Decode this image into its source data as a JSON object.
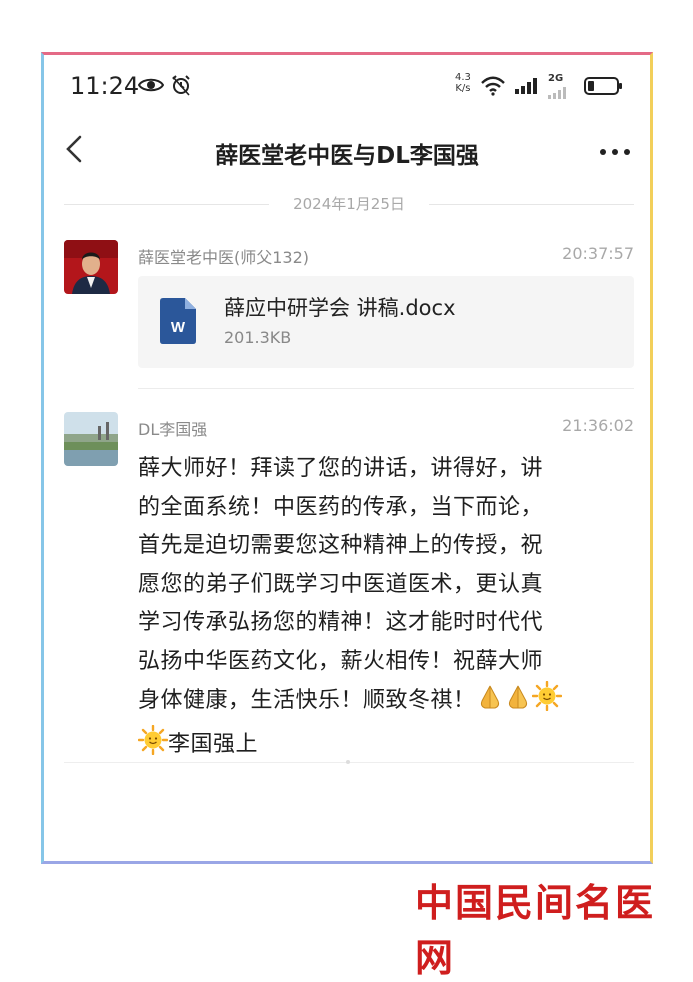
{
  "status_bar": {
    "time": "11:24",
    "net_speed_value": "4.3",
    "net_speed_unit": "K/s",
    "network_type": "2G",
    "icons": [
      "eye-icon",
      "alarm-icon",
      "wifi-icon",
      "signal-icon",
      "battery-icon"
    ]
  },
  "header": {
    "title": "薛医堂老中医与DL李国强",
    "back_icon": "chevron-left-icon",
    "more_icon": "more-dots-icon"
  },
  "date_separator": "2024年1月25日",
  "messages": [
    {
      "sender": "薛医堂老中医(师父132)",
      "time": "20:37:57",
      "type": "file",
      "file": {
        "name": "薛应中研学会 讲稿.docx",
        "size": "201.3KB",
        "icon": "word-doc-icon"
      }
    },
    {
      "sender": "DL李国强",
      "time": "21:36:02",
      "type": "text",
      "lines": [
        "薛大师好！拜读了您的讲话，讲得好，讲",
        "的全面系统！中医药的传承，当下而论，",
        "首先是迫切需要您这种精神上的传授，祝",
        "愿您的弟子们既学习中医道医术，更认真",
        "学习传承弘扬您的精神！这才能时时代代",
        "弘扬中华医药文化，薪火相传！祝薛大师",
        "身体健康，生活快乐！顺致冬祺！"
      ],
      "last_line": "李国强上",
      "emojis": [
        "folded-hands",
        "folded-hands",
        "sun"
      ]
    }
  ],
  "watermark": "中国民间名医网",
  "colors": {
    "frame_top": "#e46a86",
    "frame_right": "#f2cf5a",
    "frame_bottom": "#9aa6e6",
    "frame_left": "#86c6e8",
    "watermark": "#cf1e1e",
    "word_blue": "#2b579a"
  }
}
